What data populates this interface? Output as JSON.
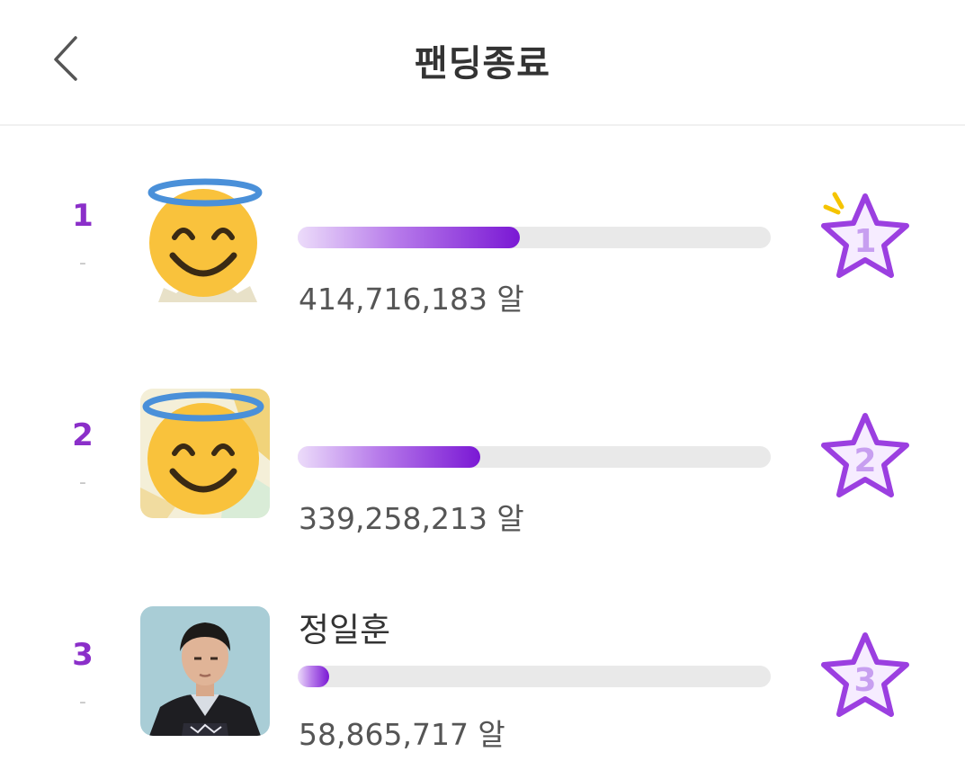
{
  "header": {
    "title": "팬딩종료"
  },
  "ranking": [
    {
      "rank": "1",
      "change": "-",
      "name": "",
      "amount": "414,716,183 알",
      "progress_fraction": 0.47,
      "medal": "1",
      "avatar": "angel-emoji"
    },
    {
      "rank": "2",
      "change": "-",
      "name": "",
      "amount": "339,258,213 알",
      "progress_fraction": 0.385,
      "medal": "2",
      "avatar": "angel-emoji"
    },
    {
      "rank": "3",
      "change": "-",
      "name": "정일훈",
      "amount": "58,865,717 알",
      "progress_fraction": 0.067,
      "medal": "3",
      "avatar": "person-photo"
    }
  ],
  "colors": {
    "accent": "#8b2fc9",
    "bar_track": "#e9e9e9",
    "bar_fill_end": "#7a18d4",
    "medal_stroke": "#9b3fe0",
    "spark": "#f5c400"
  }
}
